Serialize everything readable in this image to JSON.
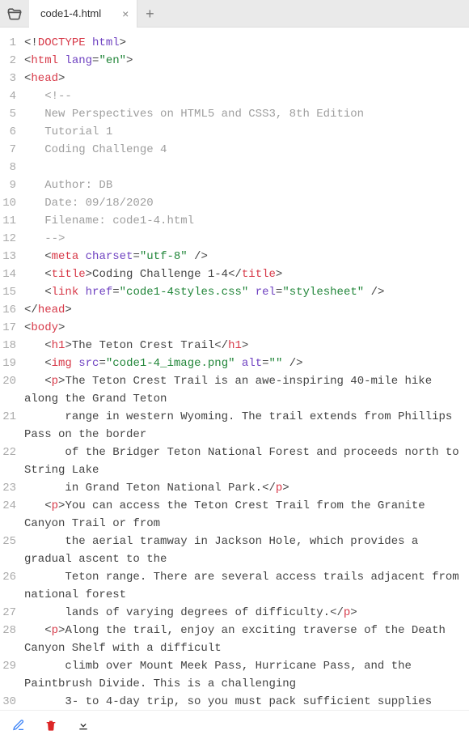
{
  "tab": {
    "title": "code1-4.html"
  },
  "lines": [
    {
      "n": 1,
      "html": "<span class='b'>&lt;!</span><span class='t'>DOCTYPE</span> <span class='a'>html</span><span class='b'>&gt;</span>"
    },
    {
      "n": 2,
      "html": "<span class='b'>&lt;</span><span class='t'>html</span> <span class='a'>lang</span><span class='b'>=</span><span class='s'>\"en\"</span><span class='b'>&gt;</span>"
    },
    {
      "n": 3,
      "html": "<span class='b'>&lt;</span><span class='t'>head</span><span class='b'>&gt;</span>"
    },
    {
      "n": 4,
      "html": "   <span class='c'>&lt;!--</span>"
    },
    {
      "n": 5,
      "html": "   <span class='c'>New Perspectives on HTML5 and CSS3, 8th Edition</span>"
    },
    {
      "n": 6,
      "html": "   <span class='c'>Tutorial 1</span>"
    },
    {
      "n": 7,
      "html": "   <span class='c'>Coding Challenge 4</span>"
    },
    {
      "n": 8,
      "html": ""
    },
    {
      "n": 9,
      "html": "   <span class='c'>Author: DB</span>"
    },
    {
      "n": 10,
      "html": "   <span class='c'>Date: 09/18/2020</span>"
    },
    {
      "n": 11,
      "html": "   <span class='c'>Filename: code1-4.html</span>"
    },
    {
      "n": 12,
      "html": "   <span class='c'>--&gt;</span>"
    },
    {
      "n": 13,
      "html": "   <span class='b'>&lt;</span><span class='t'>meta</span> <span class='a'>charset</span><span class='b'>=</span><span class='s'>\"utf-8\"</span> <span class='b'>/&gt;</span>"
    },
    {
      "n": 14,
      "html": "   <span class='b'>&lt;</span><span class='t'>title</span><span class='b'>&gt;</span><span class='tx'>Coding Challenge 1-4</span><span class='b'>&lt;/</span><span class='t'>title</span><span class='b'>&gt;</span>"
    },
    {
      "n": 15,
      "html": "   <span class='b'>&lt;</span><span class='t'>link</span> <span class='a'>href</span><span class='b'>=</span><span class='s'>\"code1-4styles.css\"</span> <span class='a'>rel</span><span class='b'>=</span><span class='s'>\"stylesheet\"</span> <span class='b'>/&gt;</span>"
    },
    {
      "n": 16,
      "html": "<span class='b'>&lt;/</span><span class='t'>head</span><span class='b'>&gt;</span>"
    },
    {
      "n": 17,
      "html": "<span class='b'>&lt;</span><span class='t'>body</span><span class='b'>&gt;</span>"
    },
    {
      "n": 18,
      "html": "   <span class='b'>&lt;</span><span class='t'>h1</span><span class='b'>&gt;</span><span class='tx'>The Teton Crest Trail</span><span class='b'>&lt;/</span><span class='t'>h1</span><span class='b'>&gt;</span>"
    },
    {
      "n": 19,
      "html": "   <span class='b'>&lt;</span><span class='t'>img</span> <span class='a'>src</span><span class='b'>=</span><span class='s'>\"code1-4_image.png\"</span> <span class='a'>alt</span><span class='b'>=</span><span class='s'>\"\"</span> <span class='b'>/&gt;</span>"
    },
    {
      "n": 20,
      "html": "   <span class='b'>&lt;</span><span class='t'>p</span><span class='b'>&gt;</span><span class='tx'>The Teton Crest Trail is an awe-inspiring 40-mile hike along the Grand Teton</span>"
    },
    {
      "n": 21,
      "html": "      <span class='tx'>range in western Wyoming. The trail extends from Phillips Pass on the border</span>"
    },
    {
      "n": 22,
      "html": "      <span class='tx'>of the Bridger Teton National Forest and proceeds north to String Lake</span>"
    },
    {
      "n": 23,
      "html": "      <span class='tx'>in Grand Teton National Park.</span><span class='b'>&lt;/</span><span class='t'>p</span><span class='b'>&gt;</span>"
    },
    {
      "n": 24,
      "html": "   <span class='b'>&lt;</span><span class='t'>p</span><span class='b'>&gt;</span><span class='tx'>You can access the Teton Crest Trail from the Granite Canyon Trail or from</span>"
    },
    {
      "n": 25,
      "html": "      <span class='tx'>the aerial tramway in Jackson Hole, which provides a gradual ascent to the</span>"
    },
    {
      "n": 26,
      "html": "      <span class='tx'>Teton range. There are several access trails adjacent from national forest</span>"
    },
    {
      "n": 27,
      "html": "      <span class='tx'>lands of varying degrees of difficulty.</span><span class='b'>&lt;/</span><span class='t'>p</span><span class='b'>&gt;</span>"
    },
    {
      "n": 28,
      "html": "   <span class='b'>&lt;</span><span class='t'>p</span><span class='b'>&gt;</span><span class='tx'>Along the trail, enjoy an exciting traverse of the Death Canyon Shelf with a difficult</span>"
    },
    {
      "n": 29,
      "html": "      <span class='tx'>climb over Mount Meek Pass, Hurricane Pass, and the Paintbrush Divide. This is a challenging</span>"
    },
    {
      "n": 30,
      "html": "      <span class='tx'>3- to 4-day trip, so you must pack sufficient supplies</span>"
    }
  ]
}
